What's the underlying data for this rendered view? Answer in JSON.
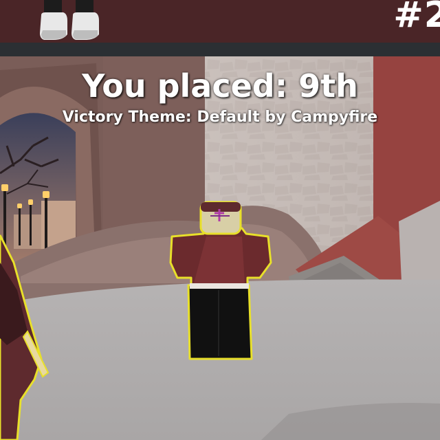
{
  "header": {
    "rank_text": "#2"
  },
  "result": {
    "title": "You placed: 9th",
    "victory_theme": "Victory Theme: Default by Campyfire"
  },
  "colors": {
    "top_bar": "#4a2527",
    "strip": "#2b2f33",
    "highlight_outline": "#e8e02a",
    "text": "#ffffff"
  },
  "icons": {
    "avatar": "avatar-icon",
    "player": "player-character-icon"
  }
}
